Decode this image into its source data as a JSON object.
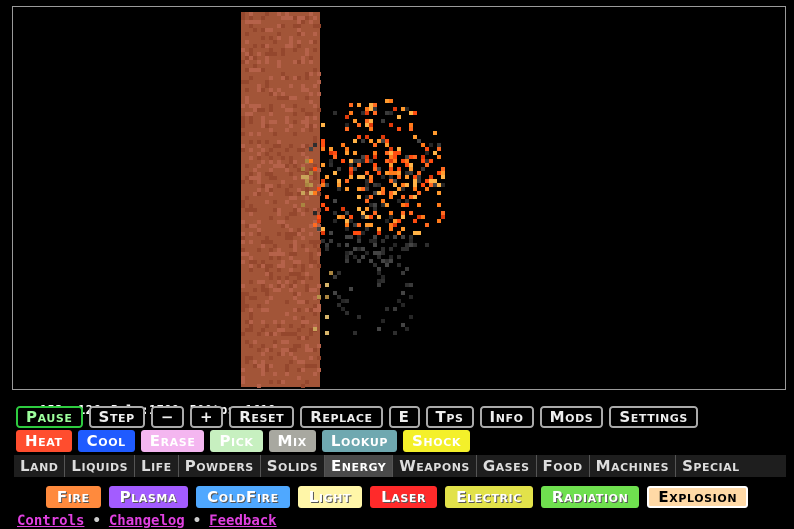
{
  "stats": {
    "cursor": "x153,y126",
    "pixels": "Pxls:1789",
    "tps": "500tps",
    "ticks": "1618"
  },
  "controls": [
    "Pause",
    "Step",
    "−",
    "+",
    "Reset",
    "Replace",
    "E",
    "Tps",
    "Info",
    "Mods",
    "Settings"
  ],
  "tools": [
    {
      "label": "Heat",
      "color": "#ff4d2e"
    },
    {
      "label": "Cool",
      "color": "#1f5bff"
    },
    {
      "label": "Erase",
      "color": "#f4b6f0"
    },
    {
      "label": "Pick",
      "color": "#c7f0c0"
    },
    {
      "label": "Mix",
      "color": "#a8a8a0"
    },
    {
      "label": "Lookup",
      "color": "#6fa8b0"
    },
    {
      "label": "Shock",
      "color": "#f4f02a"
    }
  ],
  "categories": [
    "Land",
    "Liquids",
    "Life",
    "Powders",
    "Solids",
    "Energy",
    "Weapons",
    "Gases",
    "Food",
    "Machines",
    "Special"
  ],
  "active_category": "Energy",
  "elements": [
    {
      "label": "Fire",
      "color": "#ff8a3d"
    },
    {
      "label": "Plasma",
      "color": "#a35cff"
    },
    {
      "label": "ColdFire",
      "color": "#4fa8ff"
    },
    {
      "label": "Light",
      "color": "#fff6a8"
    },
    {
      "label": "Laser",
      "color": "#ff2a2a"
    },
    {
      "label": "Electric",
      "color": "#e2e24a"
    },
    {
      "label": "Radiation",
      "color": "#6fe04f"
    },
    {
      "label": "Explosion",
      "color": "#ffd9a6"
    }
  ],
  "selected_element": "Explosion",
  "links": [
    "Controls",
    "Changelog",
    "Feedback"
  ],
  "scene": {
    "wall_color": "#a25538",
    "fire_colors": [
      "#ff4d10",
      "#ff7a1a",
      "#ff9a2e",
      "#ffb347",
      "#e03a0a",
      "#ff6a20"
    ],
    "ash_colors": [
      "#2e2e2e",
      "#3a3a3a",
      "#444444",
      "#262626"
    ],
    "sand_colors": [
      "#c9a45a",
      "#b8934a",
      "#d6b46a",
      "#a98540"
    ]
  }
}
